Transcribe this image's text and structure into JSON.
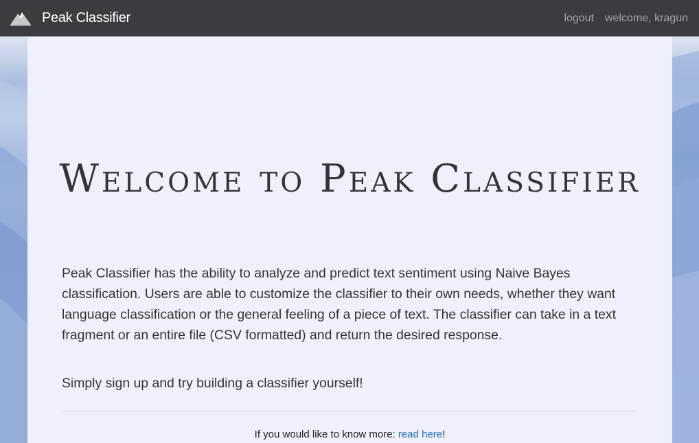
{
  "navbar": {
    "brand_logo_icon": "mountain-peak-icon",
    "brand_name": "Peak Classifier",
    "logout_label": "logout",
    "welcome_text": "welcome, kragun"
  },
  "main": {
    "title": "Welcome to Peak Classifier",
    "intro": "Peak Classifier has the ability to analyze and predict text sentiment using Naive Bayes classification. Users are able to customize the classifier to their own needs, whether they want language classification or the general feeling of a piece of text. The classifier can take in a text fragment or an entire file (CSV formatted) and return the desired response.",
    "cta": "Simply sign up and try building a classifier yourself!",
    "more_prefix": "If you would like to know more: ",
    "more_link_label": "read here",
    "more_suffix": "!"
  },
  "colors": {
    "navbar_bg": "#3a3c3f",
    "panel_bg": "#f0f0fd",
    "link": "#1a6bc6",
    "nav_link": "#a3a6aa"
  }
}
